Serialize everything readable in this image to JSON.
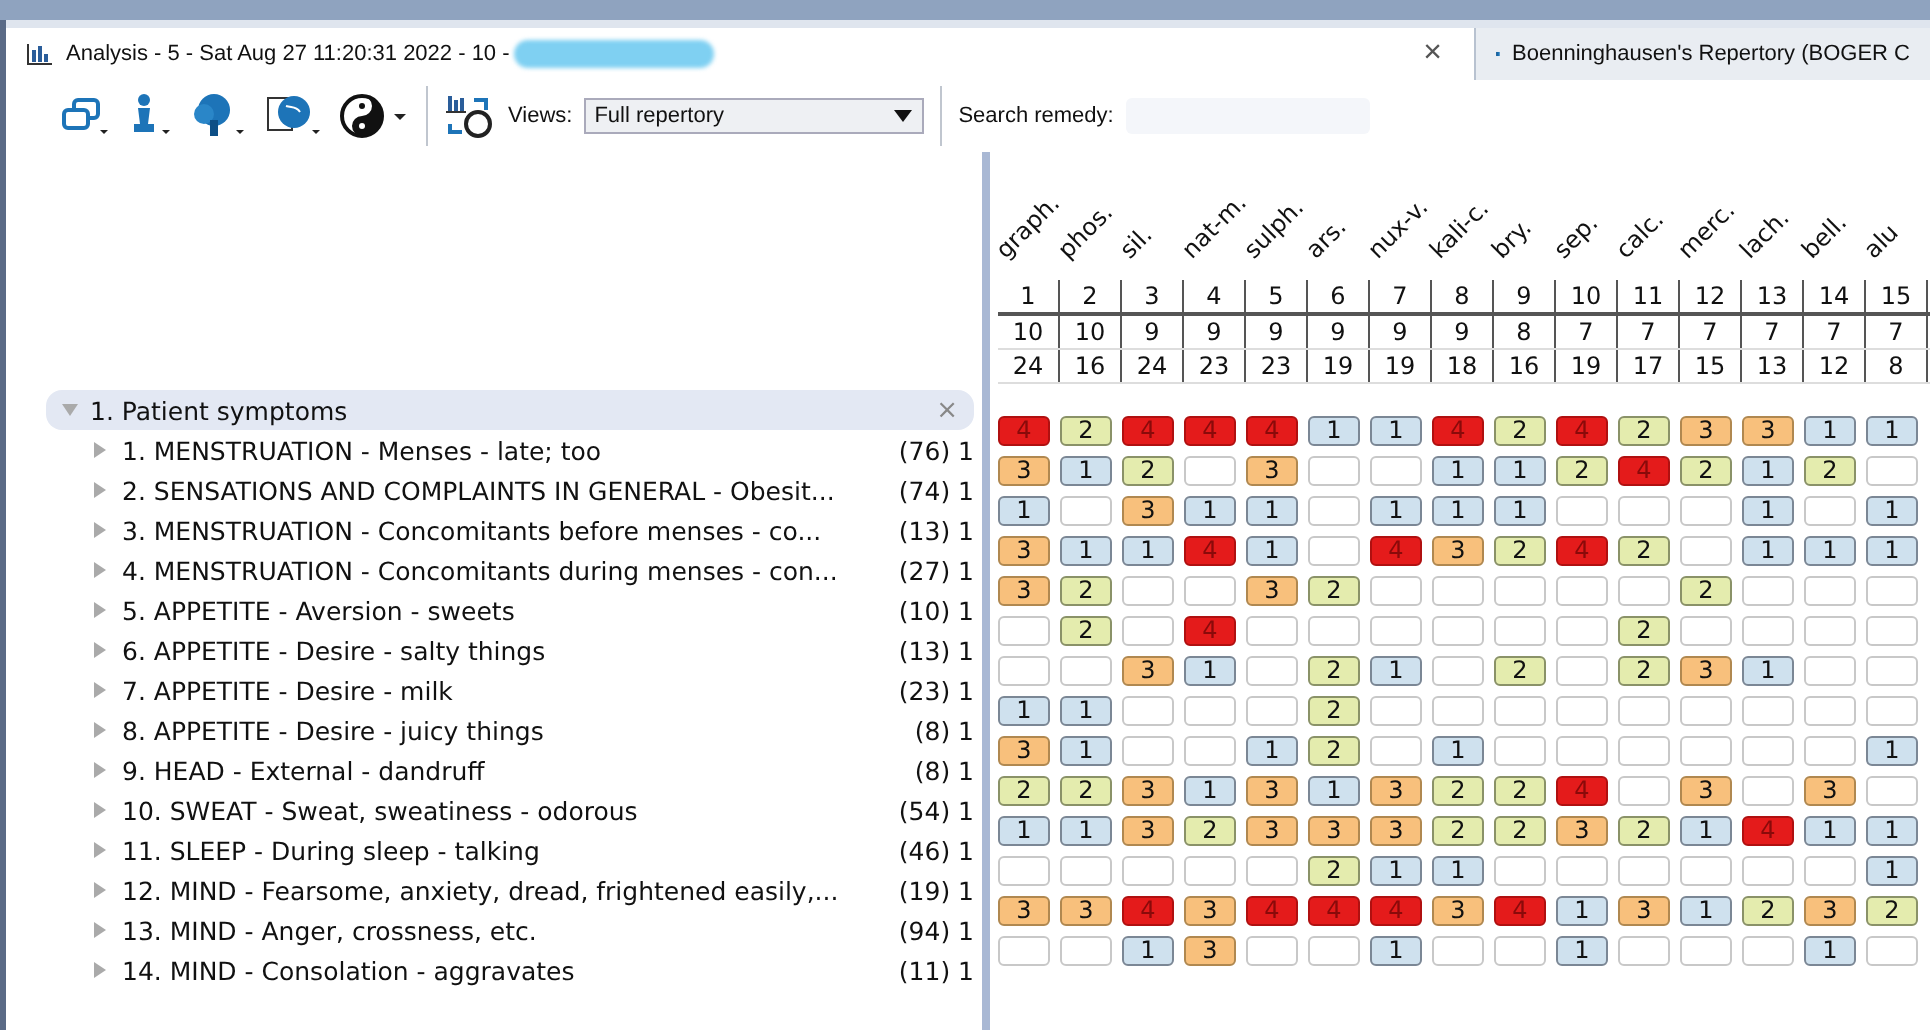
{
  "tabs": [
    {
      "title": "Analysis - 5 - Sat Aug 27 11:20:31 2022 - 10 -",
      "selected": true,
      "redacted": true,
      "close": "×"
    },
    {
      "title": "Boenninghausen's Repertory (BOGER C",
      "selected": false
    }
  ],
  "toolbar": {
    "views_label": "Views:",
    "views_value": "Full repertory",
    "search_label": "Search remedy:"
  },
  "tree": {
    "title": "1. Patient symptoms",
    "expanded": true,
    "close": "×",
    "children": [
      {
        "label": "1. MENSTRUATION - Menses - late; too",
        "count": "(76) 1"
      },
      {
        "label": "2. SENSATIONS AND COMPLAINTS IN GENERAL - Obesit...",
        "count": "(74) 1"
      },
      {
        "label": "3. MENSTRUATION - Concomitants before menses - co...",
        "count": "(13) 1"
      },
      {
        "label": "4. MENSTRUATION - Concomitants during menses - con...",
        "count": "(27) 1"
      },
      {
        "label": "5. APPETITE - Aversion - sweets",
        "count": "(10) 1"
      },
      {
        "label": "6. APPETITE - Desire - salty things",
        "count": "(13) 1"
      },
      {
        "label": "7. APPETITE - Desire - milk",
        "count": "(23) 1"
      },
      {
        "label": "8. APPETITE - Desire - juicy things",
        "count": "(8) 1"
      },
      {
        "label": "9. HEAD - External - dandruff",
        "count": "(8) 1"
      },
      {
        "label": "10. SWEAT - Sweat, sweatiness - odorous",
        "count": "(54) 1"
      },
      {
        "label": "11. SLEEP - During sleep - talking",
        "count": "(46) 1"
      },
      {
        "label": "12. MIND - Fearsome, anxiety, dread, frightened easily,...",
        "count": "(19) 1"
      },
      {
        "label": "13. MIND - Anger, crossness, etc.",
        "count": "(94) 1"
      },
      {
        "label": "14. MIND - Consolation - aggravates",
        "count": "(11) 1"
      }
    ]
  },
  "remedies": [
    {
      "name": "graph.",
      "rank": "1",
      "symptoms": "10",
      "score": "24"
    },
    {
      "name": "phos.",
      "rank": "2",
      "symptoms": "10",
      "score": "16"
    },
    {
      "name": "sil.",
      "rank": "3",
      "symptoms": "9",
      "score": "24"
    },
    {
      "name": "nat-m.",
      "rank": "4",
      "symptoms": "9",
      "score": "23"
    },
    {
      "name": "sulph.",
      "rank": "5",
      "symptoms": "9",
      "score": "23"
    },
    {
      "name": "ars.",
      "rank": "6",
      "symptoms": "9",
      "score": "19"
    },
    {
      "name": "nux-v.",
      "rank": "7",
      "symptoms": "9",
      "score": "19"
    },
    {
      "name": "kali-c.",
      "rank": "8",
      "symptoms": "9",
      "score": "18"
    },
    {
      "name": "bry.",
      "rank": "9",
      "symptoms": "8",
      "score": "16"
    },
    {
      "name": "sep.",
      "rank": "10",
      "symptoms": "7",
      "score": "19"
    },
    {
      "name": "calc.",
      "rank": "11",
      "symptoms": "7",
      "score": "17"
    },
    {
      "name": "merc.",
      "rank": "12",
      "symptoms": "7",
      "score": "15"
    },
    {
      "name": "lach.",
      "rank": "13",
      "symptoms": "7",
      "score": "13"
    },
    {
      "name": "bell.",
      "rank": "14",
      "symptoms": "7",
      "score": "12"
    },
    {
      "name": "alu",
      "rank": "15",
      "symptoms": "7",
      "score": "8"
    }
  ],
  "grades": [
    [
      {
        "kind": "grade",
        "value": "4"
      },
      {
        "kind": "grade",
        "value": "2"
      },
      {
        "kind": "grade",
        "value": "4"
      },
      {
        "kind": "grade",
        "value": "4"
      },
      {
        "kind": "grade",
        "value": "4"
      },
      {
        "kind": "grade",
        "value": "1"
      },
      {
        "kind": "grade",
        "value": "1"
      },
      {
        "kind": "grade",
        "value": "4"
      },
      {
        "kind": "grade",
        "value": "2"
      },
      {
        "kind": "grade",
        "value": "4"
      },
      {
        "kind": "grade",
        "value": "2"
      },
      {
        "kind": "grade",
        "value": "3"
      },
      {
        "kind": "grade",
        "value": "3"
      },
      {
        "kind": "grade",
        "value": "1"
      },
      {
        "kind": "grade",
        "value": "1"
      }
    ],
    [
      {
        "kind": "grade",
        "value": "3"
      },
      {
        "kind": "grade",
        "value": "1"
      },
      {
        "kind": "grade",
        "value": "2"
      },
      {
        "kind": "blank"
      },
      {
        "kind": "grade",
        "value": "3"
      },
      {
        "kind": "blank"
      },
      {
        "kind": "blank"
      },
      {
        "kind": "grade",
        "value": "1"
      },
      {
        "kind": "grade",
        "value": "1"
      },
      {
        "kind": "grade",
        "value": "2"
      },
      {
        "kind": "grade",
        "value": "4"
      },
      {
        "kind": "grade",
        "value": "2"
      },
      {
        "kind": "grade",
        "value": "1"
      },
      {
        "kind": "grade",
        "value": "2"
      },
      {
        "kind": "blank"
      }
    ],
    [
      {
        "kind": "grade",
        "value": "1"
      },
      {
        "kind": "blank"
      },
      {
        "kind": "grade",
        "value": "3"
      },
      {
        "kind": "grade",
        "value": "1"
      },
      {
        "kind": "grade",
        "value": "1"
      },
      {
        "kind": "blank"
      },
      {
        "kind": "grade",
        "value": "1"
      },
      {
        "kind": "grade",
        "value": "1"
      },
      {
        "kind": "grade",
        "value": "1"
      },
      {
        "kind": "blank"
      },
      {
        "kind": "blank"
      },
      {
        "kind": "blank"
      },
      {
        "kind": "grade",
        "value": "1"
      },
      {
        "kind": "blank"
      },
      {
        "kind": "grade",
        "value": "1"
      }
    ],
    [
      {
        "kind": "grade",
        "value": "3"
      },
      {
        "kind": "grade",
        "value": "1"
      },
      {
        "kind": "grade",
        "value": "1"
      },
      {
        "kind": "grade",
        "value": "4"
      },
      {
        "kind": "grade",
        "value": "1"
      },
      {
        "kind": "blank"
      },
      {
        "kind": "grade",
        "value": "4"
      },
      {
        "kind": "grade",
        "value": "3"
      },
      {
        "kind": "grade",
        "value": "2"
      },
      {
        "kind": "grade",
        "value": "4"
      },
      {
        "kind": "grade",
        "value": "2"
      },
      {
        "kind": "blank"
      },
      {
        "kind": "grade",
        "value": "1"
      },
      {
        "kind": "grade",
        "value": "1"
      },
      {
        "kind": "grade",
        "value": "1"
      }
    ],
    [
      {
        "kind": "grade",
        "value": "3"
      },
      {
        "kind": "grade",
        "value": "2"
      },
      {
        "kind": "blank"
      },
      {
        "kind": "blank"
      },
      {
        "kind": "grade",
        "value": "3"
      },
      {
        "kind": "grade",
        "value": "2"
      },
      {
        "kind": "blank"
      },
      {
        "kind": "blank"
      },
      {
        "kind": "blank"
      },
      {
        "kind": "blank"
      },
      {
        "kind": "blank"
      },
      {
        "kind": "grade",
        "value": "2"
      },
      {
        "kind": "blank"
      },
      {
        "kind": "blank"
      },
      {
        "kind": "blank"
      }
    ],
    [
      {
        "kind": "blank"
      },
      {
        "kind": "grade",
        "value": "2"
      },
      {
        "kind": "blank"
      },
      {
        "kind": "grade",
        "value": "4"
      },
      {
        "kind": "blank"
      },
      {
        "kind": "blank"
      },
      {
        "kind": "blank"
      },
      {
        "kind": "blank"
      },
      {
        "kind": "blank"
      },
      {
        "kind": "blank"
      },
      {
        "kind": "grade",
        "value": "2"
      },
      {
        "kind": "blank"
      },
      {
        "kind": "blank"
      },
      {
        "kind": "blank"
      },
      {
        "kind": "blank"
      }
    ],
    [
      {
        "kind": "blank"
      },
      {
        "kind": "blank"
      },
      {
        "kind": "grade",
        "value": "3"
      },
      {
        "kind": "grade",
        "value": "1"
      },
      {
        "kind": "blank"
      },
      {
        "kind": "grade",
        "value": "2"
      },
      {
        "kind": "grade",
        "value": "1"
      },
      {
        "kind": "blank"
      },
      {
        "kind": "grade",
        "value": "2"
      },
      {
        "kind": "blank"
      },
      {
        "kind": "grade",
        "value": "2"
      },
      {
        "kind": "grade",
        "value": "3"
      },
      {
        "kind": "grade",
        "value": "1"
      },
      {
        "kind": "blank"
      },
      {
        "kind": "blank"
      }
    ],
    [
      {
        "kind": "grade",
        "value": "1"
      },
      {
        "kind": "grade",
        "value": "1"
      },
      {
        "kind": "blank"
      },
      {
        "kind": "blank"
      },
      {
        "kind": "blank"
      },
      {
        "kind": "grade",
        "value": "2"
      },
      {
        "kind": "blank"
      },
      {
        "kind": "blank"
      },
      {
        "kind": "blank"
      },
      {
        "kind": "blank"
      },
      {
        "kind": "blank"
      },
      {
        "kind": "blank"
      },
      {
        "kind": "blank"
      },
      {
        "kind": "blank"
      },
      {
        "kind": "blank"
      }
    ],
    [
      {
        "kind": "grade",
        "value": "3"
      },
      {
        "kind": "grade",
        "value": "1"
      },
      {
        "kind": "blank"
      },
      {
        "kind": "blank"
      },
      {
        "kind": "grade",
        "value": "1"
      },
      {
        "kind": "grade",
        "value": "2"
      },
      {
        "kind": "blank"
      },
      {
        "kind": "grade",
        "value": "1"
      },
      {
        "kind": "blank"
      },
      {
        "kind": "blank"
      },
      {
        "kind": "blank"
      },
      {
        "kind": "blank"
      },
      {
        "kind": "blank"
      },
      {
        "kind": "blank"
      },
      {
        "kind": "grade",
        "value": "1"
      }
    ],
    [
      {
        "kind": "grade",
        "value": "2"
      },
      {
        "kind": "grade",
        "value": "2"
      },
      {
        "kind": "grade",
        "value": "3"
      },
      {
        "kind": "grade",
        "value": "1"
      },
      {
        "kind": "grade",
        "value": "3"
      },
      {
        "kind": "grade",
        "value": "1"
      },
      {
        "kind": "grade",
        "value": "3"
      },
      {
        "kind": "grade",
        "value": "2"
      },
      {
        "kind": "grade",
        "value": "2"
      },
      {
        "kind": "grade",
        "value": "4"
      },
      {
        "kind": "blank"
      },
      {
        "kind": "grade",
        "value": "3"
      },
      {
        "kind": "blank"
      },
      {
        "kind": "grade",
        "value": "3"
      },
      {
        "kind": "blank"
      }
    ],
    [
      {
        "kind": "grade",
        "value": "1"
      },
      {
        "kind": "grade",
        "value": "1"
      },
      {
        "kind": "grade",
        "value": "3"
      },
      {
        "kind": "grade",
        "value": "2"
      },
      {
        "kind": "grade",
        "value": "3"
      },
      {
        "kind": "grade",
        "value": "3"
      },
      {
        "kind": "grade",
        "value": "3"
      },
      {
        "kind": "grade",
        "value": "2"
      },
      {
        "kind": "grade",
        "value": "2"
      },
      {
        "kind": "grade",
        "value": "3"
      },
      {
        "kind": "grade",
        "value": "2"
      },
      {
        "kind": "grade",
        "value": "1"
      },
      {
        "kind": "grade",
        "value": "4"
      },
      {
        "kind": "grade",
        "value": "1"
      },
      {
        "kind": "grade",
        "value": "1"
      }
    ],
    [
      {
        "kind": "blank"
      },
      {
        "kind": "blank"
      },
      {
        "kind": "blank"
      },
      {
        "kind": "blank"
      },
      {
        "kind": "blank"
      },
      {
        "kind": "grade",
        "value": "2"
      },
      {
        "kind": "grade",
        "value": "1"
      },
      {
        "kind": "grade",
        "value": "1"
      },
      {
        "kind": "blank"
      },
      {
        "kind": "blank"
      },
      {
        "kind": "blank"
      },
      {
        "kind": "blank"
      },
      {
        "kind": "blank"
      },
      {
        "kind": "blank"
      },
      {
        "kind": "grade",
        "value": "1"
      }
    ],
    [
      {
        "kind": "grade",
        "value": "3"
      },
      {
        "kind": "grade",
        "value": "3"
      },
      {
        "kind": "grade",
        "value": "4"
      },
      {
        "kind": "grade",
        "value": "3"
      },
      {
        "kind": "grade",
        "value": "4"
      },
      {
        "kind": "grade",
        "value": "4"
      },
      {
        "kind": "grade",
        "value": "4"
      },
      {
        "kind": "grade",
        "value": "3"
      },
      {
        "kind": "grade",
        "value": "4"
      },
      {
        "kind": "grade",
        "value": "1"
      },
      {
        "kind": "grade",
        "value": "3"
      },
      {
        "kind": "grade",
        "value": "1"
      },
      {
        "kind": "grade",
        "value": "2"
      },
      {
        "kind": "grade",
        "value": "3"
      },
      {
        "kind": "grade",
        "value": "2"
      }
    ],
    [
      {
        "kind": "blank"
      },
      {
        "kind": "blank"
      },
      {
        "kind": "grade",
        "value": "1"
      },
      {
        "kind": "grade",
        "value": "3"
      },
      {
        "kind": "blank"
      },
      {
        "kind": "blank"
      },
      {
        "kind": "grade",
        "value": "1"
      },
      {
        "kind": "blank"
      },
      {
        "kind": "blank"
      },
      {
        "kind": "grade",
        "value": "1"
      },
      {
        "kind": "blank"
      },
      {
        "kind": "blank"
      },
      {
        "kind": "blank"
      },
      {
        "kind": "grade",
        "value": "1"
      },
      {
        "kind": "blank"
      }
    ]
  ]
}
